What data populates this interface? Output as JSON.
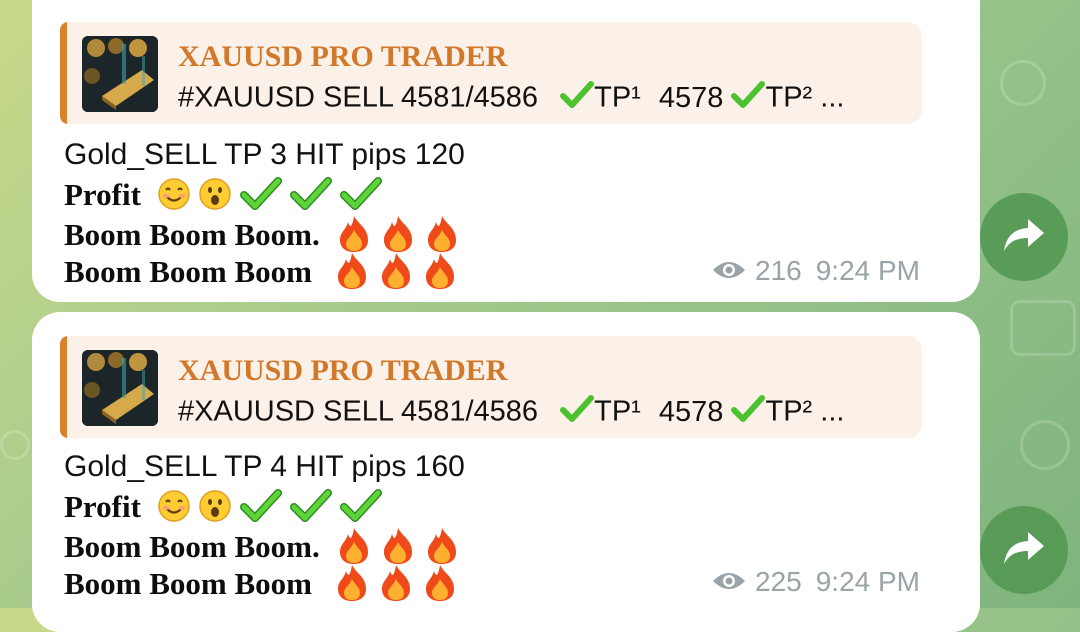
{
  "messages": [
    {
      "reply": {
        "title": "XAUUSD PRO TRADER",
        "text": "#XAUUSD SELL 4581/4586",
        "tp1_label": "TP¹",
        "tp1_value": "4578",
        "tp2_label": "TP² ..."
      },
      "line1": "Gold_SELL TP 3 HIT pips 120",
      "line2": "Profit",
      "line3": "Boom Boom Boom.",
      "line4": "Boom Boom Boom",
      "views": "216",
      "time": "9:24 PM"
    },
    {
      "reply": {
        "title": "XAUUSD PRO TRADER",
        "text": "#XAUUSD SELL 4581/4586",
        "tp1_label": "TP¹",
        "tp1_value": "4578",
        "tp2_label": "TP² ..."
      },
      "line1": "Gold_SELL TP 4 HIT pips 160",
      "line2": "Profit",
      "line3": "Boom Boom Boom.",
      "line4": "Boom Boom Boom",
      "views": "225",
      "time": "9:24 PM"
    }
  ],
  "icons": {
    "views": "eye-icon",
    "forward": "share-arrow-icon",
    "check": "check-mark-icon",
    "fire": "fire-icon",
    "smile": "smiling-face-icon",
    "surprised": "surprised-face-icon"
  },
  "colors": {
    "reply_accent": "#d9822b",
    "reply_title": "#d2782a",
    "check": "#4cc230",
    "forward_button": "#5a9a54",
    "meta_text": "#9aa3a8"
  }
}
